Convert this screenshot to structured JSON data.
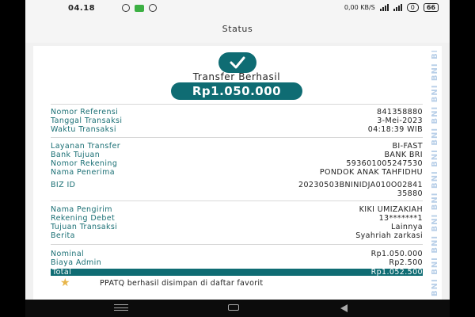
{
  "statusbar": {
    "time": "04.18",
    "net_speed": "0,00",
    "net_unit": "KB/S",
    "pill_label": "0",
    "battery": "66"
  },
  "header": {
    "title": "Status"
  },
  "receipt": {
    "title": "Transfer Berhasil",
    "amount": "Rp1.050.000",
    "watermark": "BNI BNI BNI BNI BNI BNI BNI BNI BNI BNI BNI BNI",
    "group1": [
      {
        "label": "Nomor Referensi",
        "value": "841358880"
      },
      {
        "label": "Tanggal Transaksi",
        "value": "3-Mei-2023"
      },
      {
        "label": "Waktu Transaksi",
        "value": "04:18:39 WIB"
      }
    ],
    "group2": [
      {
        "label": "Layanan Transfer",
        "value": "BI-FAST"
      },
      {
        "label": "Bank Tujuan",
        "value": "BANK BRI"
      },
      {
        "label": "Nomor Rekening",
        "value": "593601005247530"
      },
      {
        "label": "Nama Penerima",
        "value": "PONDOK ANAK TAHFIDHU"
      }
    ],
    "biz": {
      "label": "BIZ ID",
      "value_line1": "20230503BNINIDJA010O02841",
      "value_line2": "35880"
    },
    "group3": [
      {
        "label": "Nama Pengirim",
        "value": "KIKI UMIZAKIAH"
      },
      {
        "label": "Rekening Debet",
        "value": "13*******1"
      },
      {
        "label": "Tujuan Transaksi",
        "value": "Lainnya"
      },
      {
        "label": "Berita",
        "value": "Syahriah zarkasi"
      }
    ],
    "group4": [
      {
        "label": "Nominal",
        "value": "Rp1.050.000"
      },
      {
        "label": "Biaya Admin",
        "value": "Rp2.500"
      }
    ],
    "total": {
      "label": "Total",
      "value": "Rp1.052.500"
    },
    "favorite_text": "PPATQ berhasil disimpan di daftar favorit"
  },
  "colors": {
    "accent": "#0f6c73",
    "star": "#e7b54a",
    "label": "#1a6f74"
  },
  "icons": [
    "check-icon",
    "star-icon",
    "recent-apps-icon",
    "home-icon",
    "back-icon"
  ]
}
